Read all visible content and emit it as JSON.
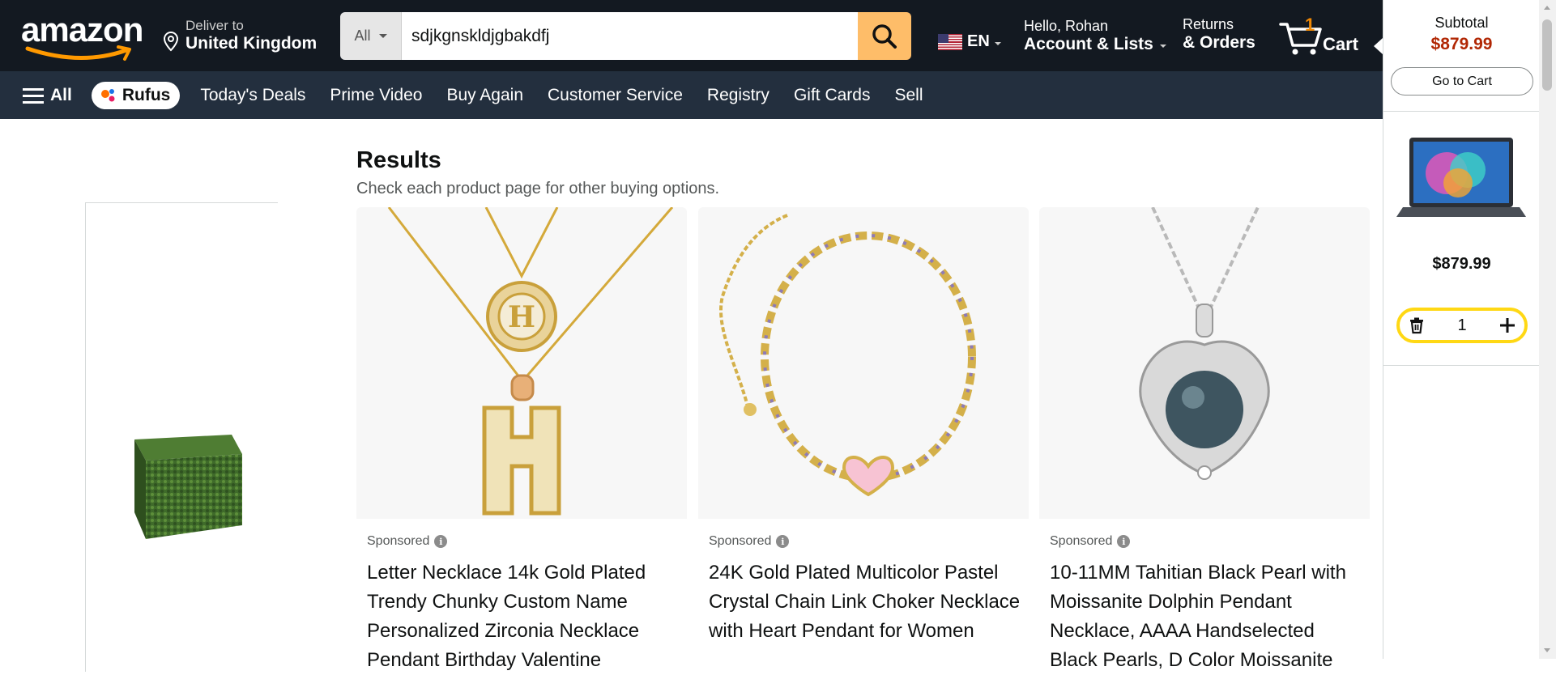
{
  "header": {
    "logo_text": "amazon",
    "deliver_line1": "Deliver to",
    "deliver_line2": "United Kingdom",
    "search_category": "All",
    "search_value": "sdjkgnskldjgbakdfj",
    "language": "EN",
    "account_line1": "Hello, Rohan",
    "account_line2": "Account & Lists",
    "orders_line1": "Returns",
    "orders_line2": "& Orders",
    "cart_count": "1",
    "cart_label": "Cart"
  },
  "nav": {
    "all_label": "All",
    "rufus_label": "Rufus",
    "links": [
      "Today's Deals",
      "Prime Video",
      "Buy Again",
      "Customer Service",
      "Registry",
      "Gift Cards",
      "Sell"
    ]
  },
  "results": {
    "title": "Results",
    "subtitle": "Check each product page for other buying options.",
    "products": [
      {
        "sponsored": "Sponsored",
        "title": "Letter Necklace 14k Gold Plated Trendy Chunky Custom Name Personalized Zirconia Necklace Pendant Birthday Valentine"
      },
      {
        "sponsored": "Sponsored",
        "title": "24K Gold Plated Multicolor Pastel Crystal Chain Link Choker Necklace with Heart Pendant for Women"
      },
      {
        "sponsored": "Sponsored",
        "title": "10-11MM Tahitian Black Pearl with Moissanite Dolphin Pendant Necklace, AAAA Handselected Black Pearls, D Color Moissanite"
      }
    ]
  },
  "cart_panel": {
    "subtotal_label": "Subtotal",
    "subtotal_value": "$879.99",
    "go_to_cart": "Go to Cart",
    "item_price": "$879.99",
    "quantity": "1"
  },
  "colors": {
    "header_bg": "#131921",
    "nav_bg": "#232f3e",
    "search_button": "#febd69",
    "price_red": "#b12704",
    "cart_count": "#f08804",
    "qty_border": "#ffd814"
  }
}
